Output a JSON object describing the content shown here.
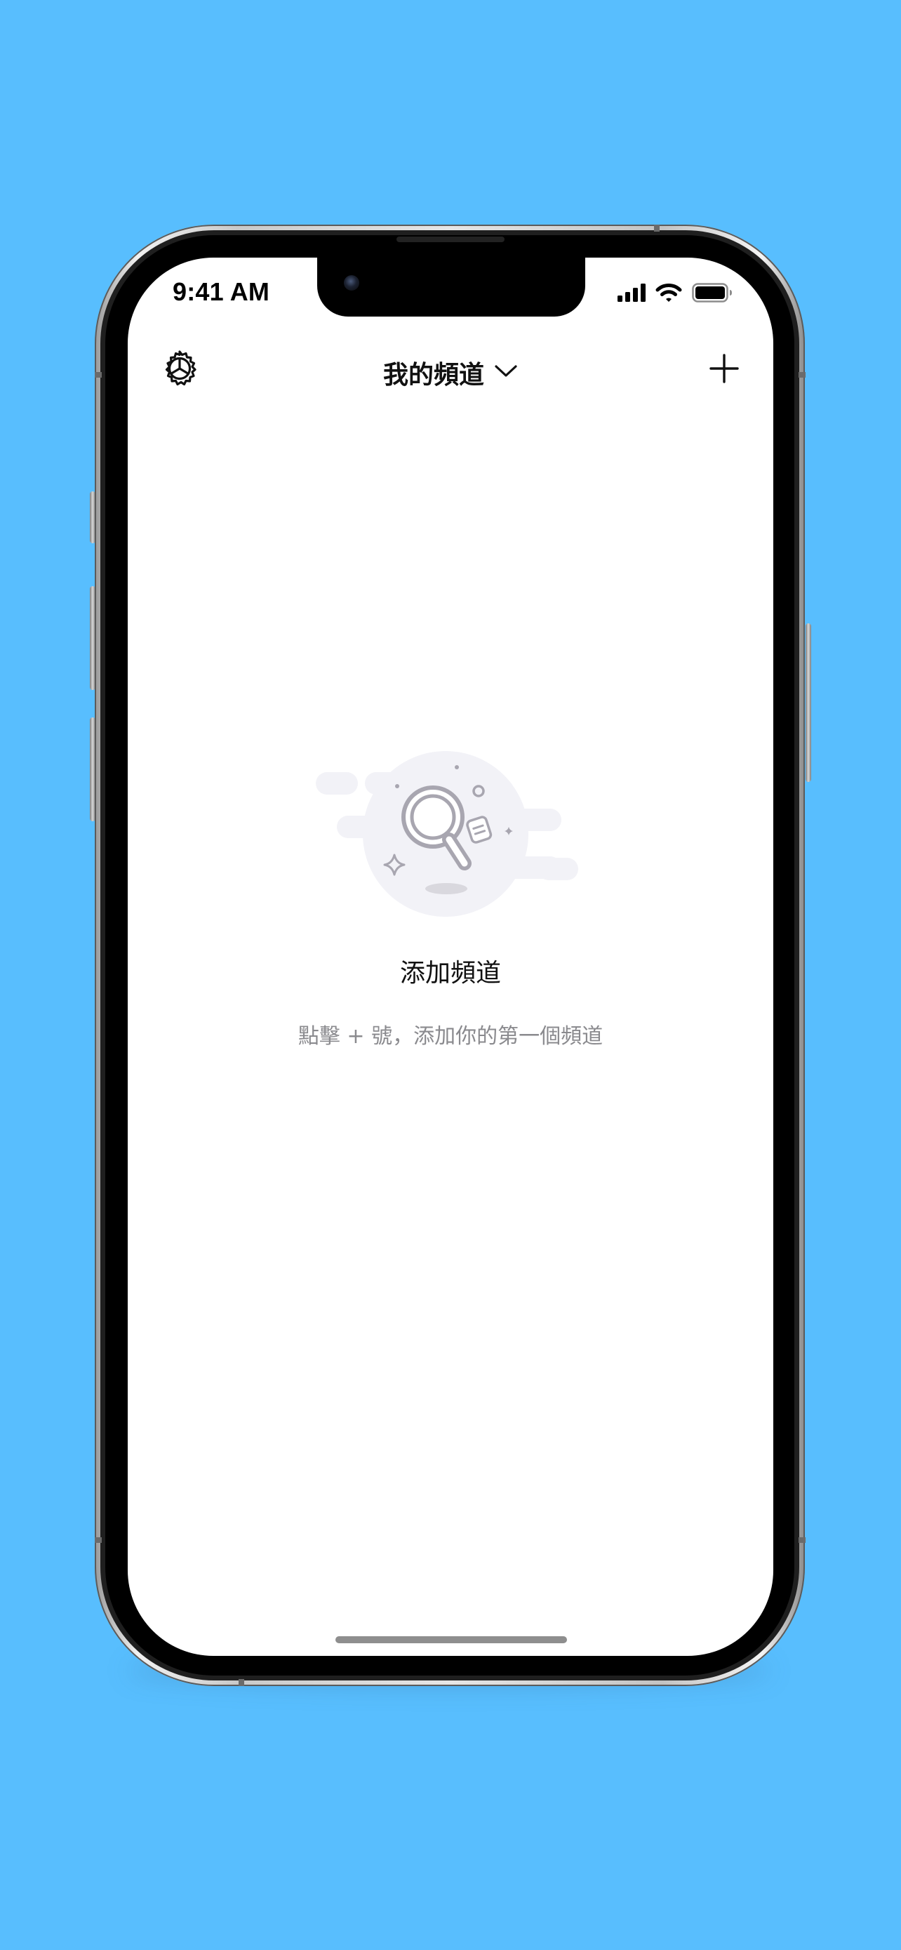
{
  "status_bar": {
    "time": "9:41 AM",
    "icons": [
      "cellular-signal-icon",
      "wifi-icon",
      "battery-icon"
    ]
  },
  "nav": {
    "left_icon": "settings-gear-icon",
    "title": "我的頻道",
    "title_icon": "chevron-down-icon",
    "right_icon": "plus-icon"
  },
  "empty_state": {
    "illustration": "magnifier-search-illustration",
    "title": "添加頻道",
    "subtitle": "點擊 + 號，添加你的第一個頻道"
  },
  "colors": {
    "background": "#58BEFE",
    "screen": "#FFFFFF",
    "title_text": "#111111",
    "subtitle_text": "#8A8A8E",
    "illustration_fill": "#F2F2F7",
    "illustration_stroke": "#A8A6B0"
  }
}
